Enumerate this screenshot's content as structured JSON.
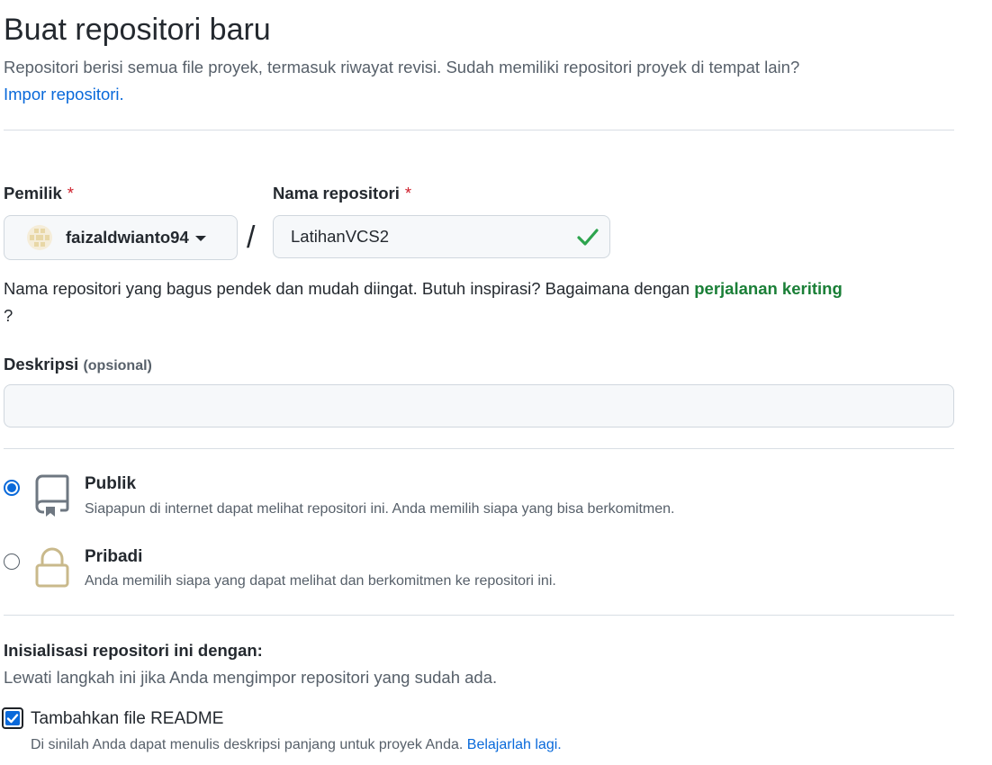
{
  "page": {
    "title": "Buat repositori baru",
    "subtitle": "Repositori berisi semua file proyek, termasuk riwayat revisi. Sudah memiliki repositori proyek di tempat lain?",
    "import_link": "Impor repositori."
  },
  "owner": {
    "label": "Pemilik",
    "required_mark": "*",
    "selected": "faizaldwianto94",
    "avatar_icon": "identicon-avatar",
    "dropdown_icon": "caret-down-icon"
  },
  "separator": "/",
  "repo_name": {
    "label": "Nama repositori",
    "required_mark": "*",
    "value": "LatihanVCS2",
    "status_icon": "check-icon",
    "status_color": "#2da44e"
  },
  "name_hint": {
    "text": "Nama repositori yang bagus pendek dan mudah diingat. Butuh inspirasi? Bagaimana dengan ",
    "suggestion": "perjalanan keriting",
    "suffix": "?"
  },
  "description": {
    "label": "Deskripsi",
    "optional_label": "(opsional)",
    "value": ""
  },
  "visibility": {
    "options": [
      {
        "label": "Publik",
        "description": "Siapapun di internet dapat melihat repositori ini. Anda memilih siapa yang bisa berkomitmen.",
        "icon": "repo-icon",
        "selected": true
      },
      {
        "label": "Pribadi",
        "description": "Anda memilih siapa yang dapat melihat dan berkomitmen ke repositori ini.",
        "icon": "lock-icon",
        "selected": false
      }
    ]
  },
  "init": {
    "title": "Inisialisasi repositori ini dengan:",
    "subtitle": "Lewati langkah ini jika Anda mengimpor repositori yang sudah ada.",
    "readme": {
      "label": "Tambahkan file README",
      "checked": true,
      "description": "Di sinilah Anda dapat menulis deskripsi panjang untuk proyek Anda.",
      "learn_more": "Belajarlah lagi."
    }
  },
  "colors": {
    "accent": "#0969da",
    "success": "#1a7f37",
    "danger": "#cf222e",
    "border": "#d0d7de"
  }
}
